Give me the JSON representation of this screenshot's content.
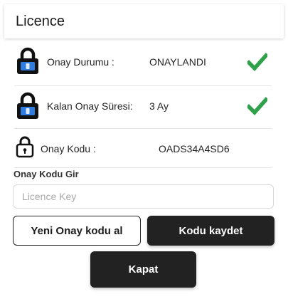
{
  "header": {
    "title": "Licence"
  },
  "rows": [
    {
      "label": "Onay Durumu :",
      "value": "ONAYLANDI"
    },
    {
      "label": "Kalan Onay Süresi:",
      "value": "3 Ay"
    },
    {
      "label": "Onay Kodu :",
      "value": "OADS34A4SD6"
    }
  ],
  "form": {
    "input_label": "Onay Kodu Gir",
    "placeholder": "Licence Key",
    "value": ""
  },
  "buttons": {
    "new_code": "Yeni Onay kodu al",
    "save_code": "Kodu kaydet",
    "close": "Kapat"
  },
  "icons": {
    "status_lock": "lock-icon",
    "code_lock": "lock-outline-icon",
    "check": "check-icon"
  },
  "colors": {
    "accent_blue": "#2f7de1",
    "check_green": "#2fa14a",
    "button_dark": "#222222"
  }
}
